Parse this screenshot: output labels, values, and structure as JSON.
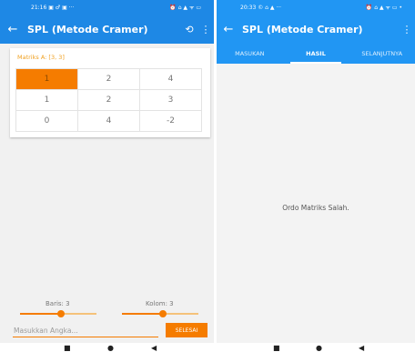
{
  "colors": {
    "left_primary": "#1e88e5",
    "right_primary": "#2196f3",
    "accent": "#f57c00",
    "label_orange": "#f0a020"
  },
  "left": {
    "status": {
      "time": "21:16",
      "icons": "▣ ♂ ▣ ···",
      "right_icons": "⏰ ⌂ ▲ ᯤ ▭"
    },
    "appbar": {
      "back_icon": "arrow-left-icon",
      "title": "SPL (Metode Cramer)",
      "history_icon": "history-icon",
      "menu_icon": "more-vert-icon"
    },
    "matrix": {
      "label": "Matriks A: [3, 3]",
      "rows": [
        [
          "1",
          "2",
          "4"
        ],
        [
          "1",
          "2",
          "3"
        ],
        [
          "0",
          "4",
          "-2"
        ]
      ],
      "selected": {
        "row": 0,
        "col": 0
      }
    },
    "sliders": {
      "rows_label": "Baris: 3",
      "rows_value": 3,
      "cols_label": "Kolom: 3",
      "cols_value": 3
    },
    "input": {
      "value": "",
      "placeholder": "Masukkan Angka..."
    },
    "done_button": "SELESAI"
  },
  "right": {
    "status": {
      "time": "20:33",
      "icons": "© ⌂ ▲ ···",
      "right_icons": "⏰ ⌂ ▲ ᯤ ▭ •"
    },
    "appbar": {
      "back_icon": "arrow-left-icon",
      "title": "SPL (Metode Cramer)",
      "menu_icon": "more-vert-icon"
    },
    "tabs": [
      "MASUKAN",
      "HASIL",
      "SELANJUTNYA"
    ],
    "active_tab": 1,
    "message": "Ordo Matriks Salah."
  },
  "navbar": {
    "recent": "■",
    "home": "●",
    "back": "◀"
  }
}
